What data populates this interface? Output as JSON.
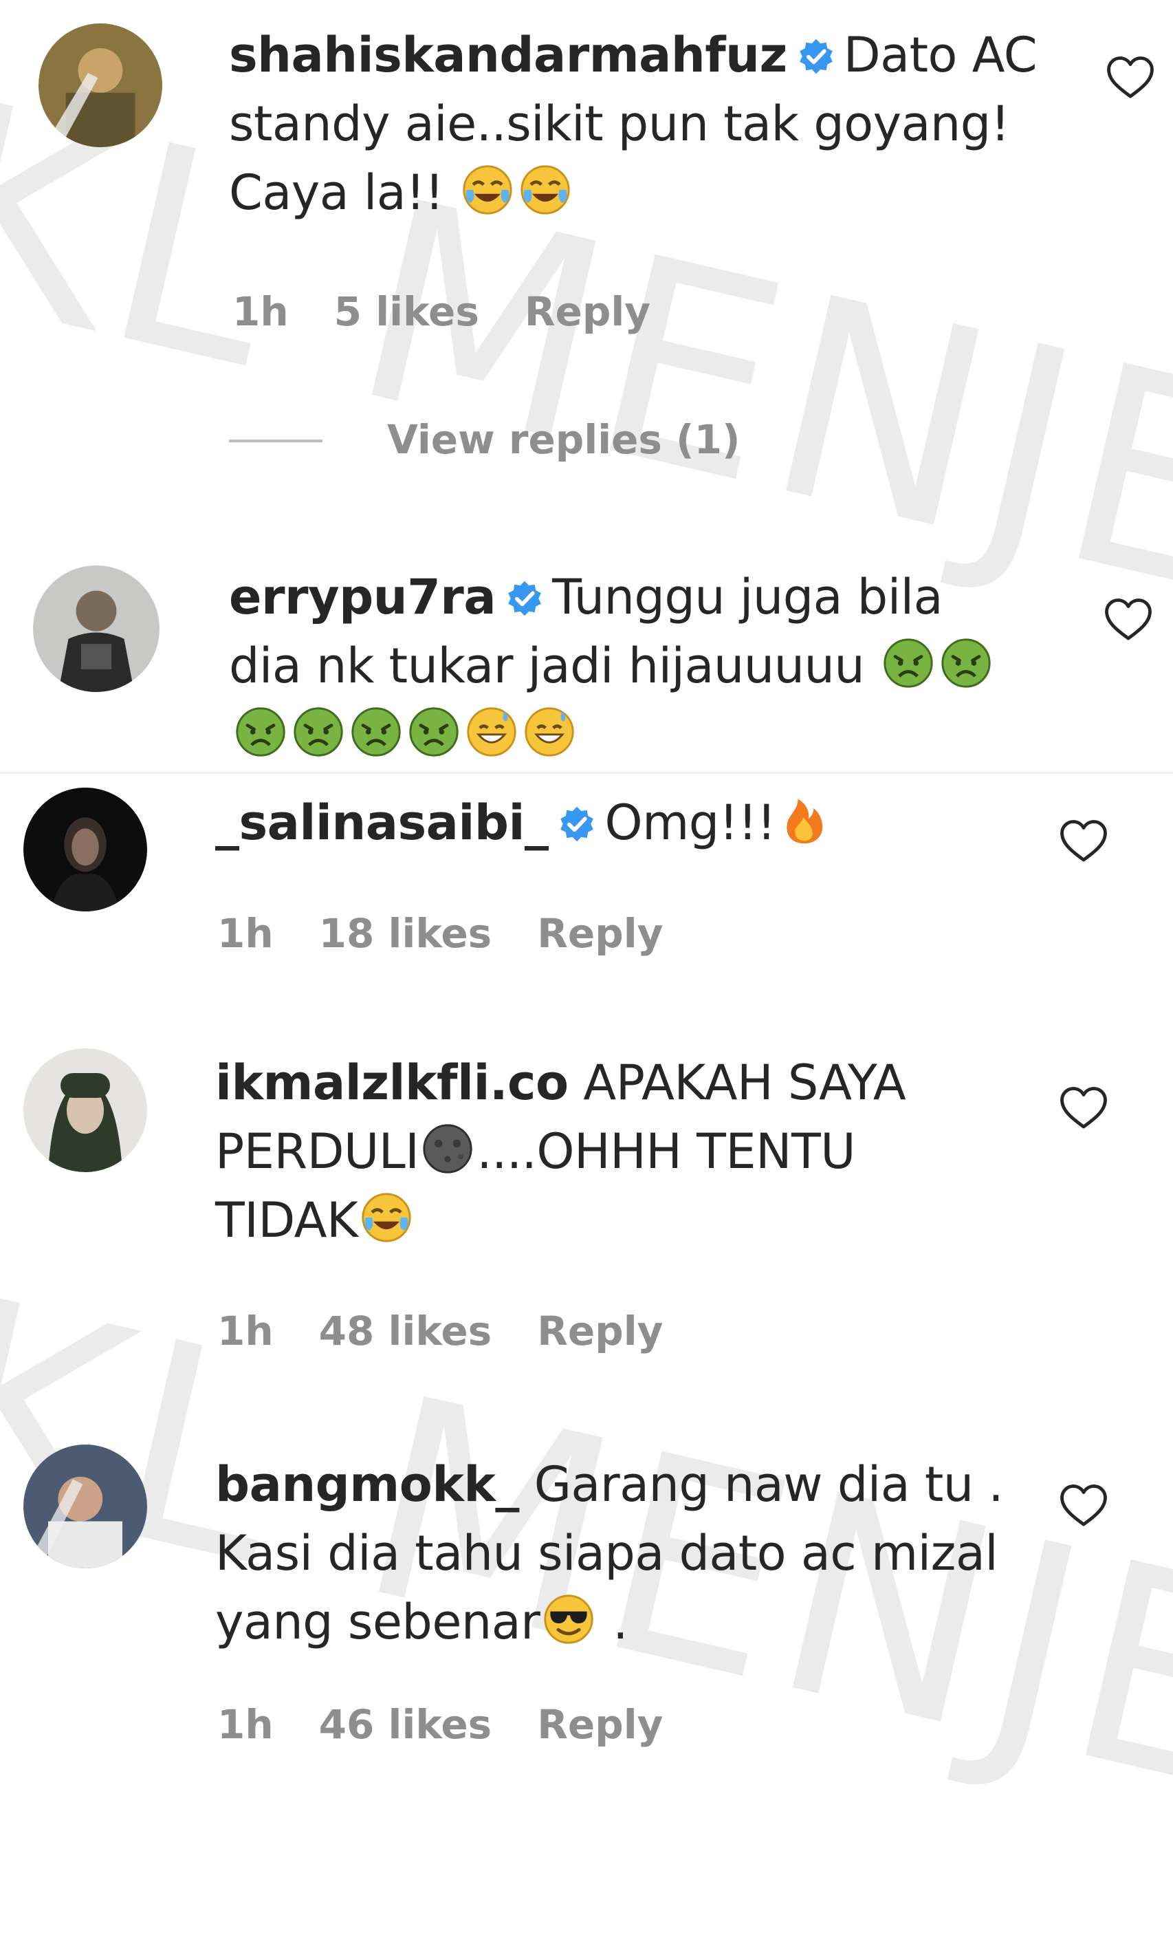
{
  "watermark": {
    "text_top": "KL MENJERIT",
    "text_bottom": "KL MENJERIT"
  },
  "colors": {
    "text": "#262626",
    "meta": "#8e8e8e",
    "verified_badge": "#3897f0",
    "heart_outline": "#262626"
  },
  "view_replies_label": "View replies (1)",
  "comments": [
    {
      "username": "shahiskandarmahfuz",
      "verified": true,
      "lines": [
        "Dato AC",
        "standy aie..sikit pun tak goyang!",
        "Caya la!!"
      ],
      "emojis": [
        "face-with-tears-of-joy",
        "face-with-tears-of-joy"
      ],
      "time": "1h",
      "likes": "5 likes",
      "reply": "Reply"
    },
    {
      "username": "errypu7ra",
      "verified": true,
      "lines": [
        "Tunggu juga bila",
        "dia nk tukar jadi hijauuuuu"
      ],
      "emojis": [
        "nauseated-face",
        "nauseated-face",
        "nauseated-face",
        "nauseated-face",
        "nauseated-face",
        "nauseated-face",
        "grinning-face-with-sweat",
        "grinning-face-with-sweat"
      ]
    },
    {
      "username": "_salinasaibi_",
      "verified": true,
      "lines": [
        "Omg!!!"
      ],
      "emojis": [
        "fire"
      ],
      "time": "1h",
      "likes": "18 likes",
      "reply": "Reply"
    },
    {
      "username": "ikmalzlkfli.co",
      "verified": false,
      "lines": [
        "APAKAH SAYA",
        "PERDULI",
        "....OHHH TENTU",
        "TIDAK"
      ],
      "emojis": [
        "new-moon-face",
        "face-with-tears-of-joy"
      ],
      "time": "1h",
      "likes": "48 likes",
      "reply": "Reply"
    },
    {
      "username": "bangmokk_",
      "verified": false,
      "lines": [
        "Garang naw dia tu .",
        "Kasi dia tahu siapa dato ac mizal",
        "yang sebenar",
        "."
      ],
      "emojis": [
        "smiling-face-with-sunglasses"
      ],
      "time": "1h",
      "likes": "46 likes",
      "reply": "Reply"
    }
  ]
}
